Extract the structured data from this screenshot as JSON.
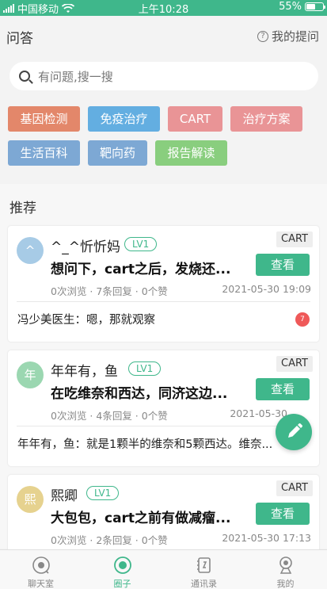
{
  "status_bar": {
    "carrier": "中国移动",
    "time": "上午10:28",
    "battery": "55%"
  },
  "header": {
    "title": "问答",
    "my_questions": "我的提问"
  },
  "search": {
    "placeholder": "有问题,搜一搜"
  },
  "tags": [
    {
      "label": "基因检测",
      "color": "#e3876a"
    },
    {
      "label": "免疫治疗",
      "color": "#63aee1"
    },
    {
      "label": "CART",
      "color": "#e99496"
    },
    {
      "label": "治疗方案",
      "color": "#e99496"
    },
    {
      "label": "生活百科",
      "color": "#7da8d4"
    },
    {
      "label": "靶向药",
      "color": "#7da8d4"
    },
    {
      "label": "报告解读",
      "color": "#89ce7e"
    }
  ],
  "section": {
    "title": "推荐"
  },
  "cards": [
    {
      "avatar_text": "^",
      "avatar_color": "#a7cbe6",
      "name": "^_^忻忻妈",
      "level": "LV1",
      "category": "CART",
      "question": "想问下，cart之后，发烧还...",
      "view_label": "查看",
      "stats": "0次浏览 · 7条回复 · 0个赞",
      "date": "2021-05-30 19:09",
      "reply": "冯少美医生：嗯，那就观察",
      "badge": "7"
    },
    {
      "avatar_text": "年",
      "avatar_color": "#9bd7b1",
      "name": "年年有，鱼",
      "level": "LV1",
      "category": "CART",
      "question": "在吃维奈和西达，同济这边...",
      "view_label": "查看",
      "stats": "0次浏览 · 4条回复 · 0个赞",
      "date": "2021-05-30",
      "reply": "年年有，鱼：就是1颗半的维奈和5颗西达。维奈...",
      "badge": ""
    },
    {
      "avatar_text": "熙",
      "avatar_color": "#e6d28f",
      "name": "熙卿",
      "level": "LV1",
      "category": "CART",
      "question": "大包包，cart之前有做减瘤...",
      "view_label": "查看",
      "stats": "0次浏览 · 2条回复 · 0个赞",
      "date": "2021-05-30 17:13",
      "reply": "",
      "badge": ""
    }
  ],
  "tabbar": [
    {
      "label": "聊天室",
      "icon": "chat-room-icon"
    },
    {
      "label": "圈子",
      "icon": "circle-icon"
    },
    {
      "label": "通讯录",
      "icon": "contacts-icon"
    },
    {
      "label": "我的",
      "icon": "profile-icon"
    }
  ],
  "colors": {
    "accent": "#3fb78b"
  }
}
